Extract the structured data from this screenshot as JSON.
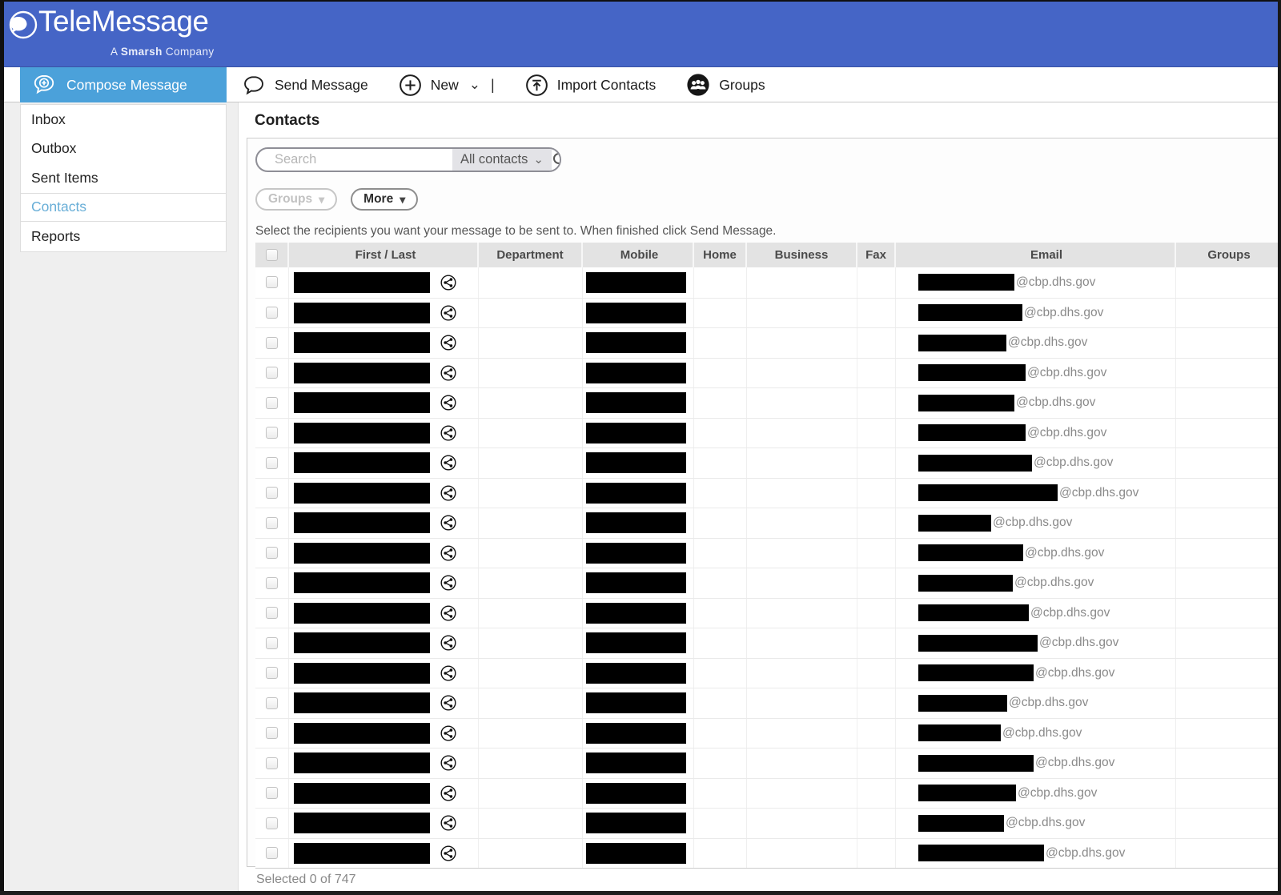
{
  "header": {
    "logo": "TeleMessage",
    "tagline": {
      "a": "A",
      "smarsh": "Smarsh",
      "company": "Company"
    }
  },
  "toolbar": {
    "compose_label": "Compose Message",
    "send_label": "Send Message",
    "new_label": "New",
    "new_separator": "|",
    "import_label": "Import Contacts",
    "groups_label": "Groups"
  },
  "sidebar": {
    "items": [
      {
        "label": "Inbox",
        "active": false
      },
      {
        "label": "Outbox",
        "active": false
      },
      {
        "label": "Sent Items",
        "active": false
      },
      {
        "label": "Contacts",
        "active": true
      },
      {
        "label": "Reports",
        "active": false
      }
    ]
  },
  "main": {
    "title": "Contacts",
    "instruction": "Select the recipients you want your message to be sent to. When finished click Send Message.",
    "selected_status": "Selected 0 of 747"
  },
  "search": {
    "placeholder": "Search",
    "filter_value": "All contacts"
  },
  "filters": {
    "groups_button": "Groups",
    "more_button": "More"
  },
  "icons": {
    "caret_small": "⌄",
    "caret_filled": "▾"
  },
  "table": {
    "columns": [
      "First / Last",
      "Department",
      "Mobile",
      "Home",
      "Business",
      "Fax",
      "Email",
      "Groups"
    ],
    "redaction": {
      "name_bar_width": 170,
      "mobile_bar_width": 125
    },
    "rows": [
      {
        "email_bar_width": 120,
        "email_suffix": "@cbp.dhs.gov"
      },
      {
        "email_bar_width": 130,
        "email_suffix": "@cbp.dhs.gov"
      },
      {
        "email_bar_width": 110,
        "email_suffix": "@cbp.dhs.gov"
      },
      {
        "email_bar_width": 134,
        "email_suffix": "@cbp.dhs.gov"
      },
      {
        "email_bar_width": 120,
        "email_suffix": "@cbp.dhs.gov"
      },
      {
        "email_bar_width": 134,
        "email_suffix": "@cbp.dhs.gov"
      },
      {
        "email_bar_width": 142,
        "email_suffix": "@cbp.dhs.gov"
      },
      {
        "email_bar_width": 174,
        "email_suffix": "@cbp.dhs.gov"
      },
      {
        "email_bar_width": 91,
        "email_suffix": "@cbp.dhs.gov"
      },
      {
        "email_bar_width": 131,
        "email_suffix": "@cbp.dhs.gov"
      },
      {
        "email_bar_width": 118,
        "email_suffix": "@cbp.dhs.gov"
      },
      {
        "email_bar_width": 138,
        "email_suffix": "@cbp.dhs.gov"
      },
      {
        "email_bar_width": 149,
        "email_suffix": "@cbp.dhs.gov"
      },
      {
        "email_bar_width": 144,
        "email_suffix": "@cbp.dhs.gov"
      },
      {
        "email_bar_width": 111,
        "email_suffix": "@cbp.dhs.gov"
      },
      {
        "email_bar_width": 103,
        "email_suffix": "@cbp.dhs.gov"
      },
      {
        "email_bar_width": 144,
        "email_suffix": "@cbp.dhs.gov"
      },
      {
        "email_bar_width": 122,
        "email_suffix": "@cbp.dhs.gov"
      },
      {
        "email_bar_width": 107,
        "email_suffix": "@cbp.dhs.gov"
      },
      {
        "email_bar_width": 157,
        "email_suffix": "@cbp.dhs.gov"
      }
    ]
  },
  "colors": {
    "header_blue": "#4565c6",
    "compose_blue": "#4ba1da",
    "active_link": "#68aed7",
    "redaction_black": "#000000"
  }
}
